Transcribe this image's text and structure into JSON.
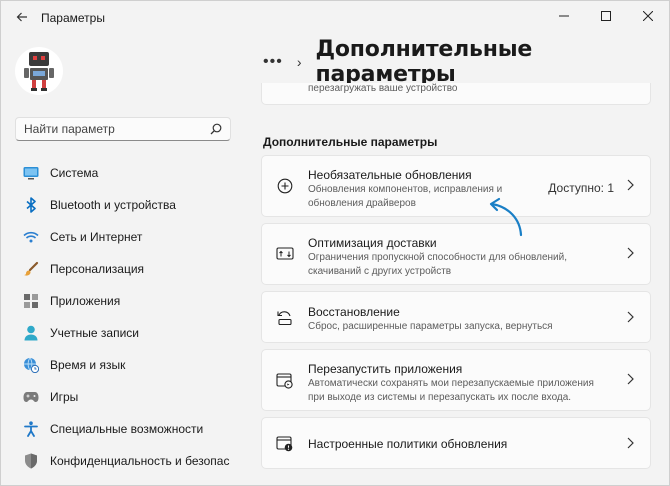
{
  "window": {
    "title": "Параметры",
    "controls": {
      "minimize": "—",
      "maximize": "☐",
      "close": "✕"
    }
  },
  "search": {
    "placeholder": "Найти параметр"
  },
  "sidebar": {
    "items": [
      {
        "label": "Система",
        "icon": "display-icon"
      },
      {
        "label": "Bluetooth и устройства",
        "icon": "bluetooth-icon"
      },
      {
        "label": "Сеть и Интернет",
        "icon": "wifi-icon"
      },
      {
        "label": "Персонализация",
        "icon": "brush-icon"
      },
      {
        "label": "Приложения",
        "icon": "apps-icon"
      },
      {
        "label": "Учетные записи",
        "icon": "person-icon"
      },
      {
        "label": "Время и язык",
        "icon": "globe-clock-icon"
      },
      {
        "label": "Игры",
        "icon": "gamepad-icon"
      },
      {
        "label": "Специальные возможности",
        "icon": "accessibility-icon"
      },
      {
        "label": "Конфиденциальность и безопас",
        "icon": "shield-icon"
      }
    ]
  },
  "breadcrumb": {
    "more": "•••",
    "separator": "›",
    "title": "Дополнительные параметры"
  },
  "partial_card": {
    "text": "перезагружать ваше устройство"
  },
  "section": {
    "title": "Дополнительные параметры"
  },
  "settings": [
    {
      "title": "Необязательные обновления",
      "desc": "Обновления компонентов, исправления и обновления драйверов",
      "status": "Доступно: 1",
      "icon": "plus-circle-icon"
    },
    {
      "title": "Оптимизация доставки",
      "desc": "Ограничения пропускной способности для обновлений, скачиваний с других устройств",
      "icon": "delivery-icon"
    },
    {
      "title": "Восстановление",
      "desc": "Сброс, расширенные параметры запуска, вернуться",
      "icon": "recovery-icon"
    },
    {
      "title": "Перезапустить приложения",
      "desc": "Автоматически сохранять мои перезапускаемые приложения при выходе из системы и перезапускать их после входа.",
      "icon": "restart-apps-icon"
    },
    {
      "title": "Настроенные политики обновления",
      "icon": "policy-icon"
    }
  ],
  "colors": {
    "accent": "#0067c0",
    "annotation_arrow": "#1a7fc6"
  }
}
